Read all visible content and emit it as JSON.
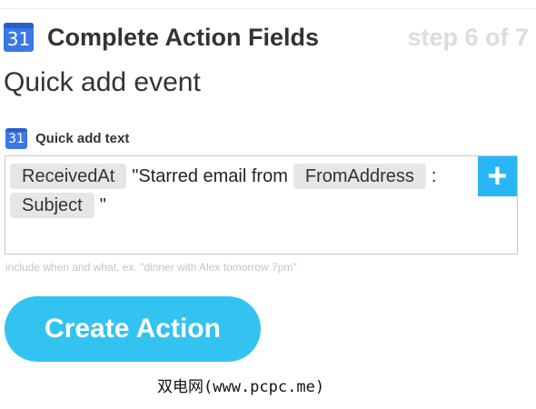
{
  "header": {
    "icon_number": "31",
    "title": "Complete Action Fields",
    "step": "step 6 of 7"
  },
  "action": {
    "name": "Quick add event"
  },
  "field": {
    "icon_number": "31",
    "label": "Quick add text",
    "line1": {
      "token1": "ReceivedAt",
      "text1": "\"Starred email from",
      "token2": "FromAddress",
      "text2": ":"
    },
    "line2": {
      "token1": "Subject",
      "text1": "\""
    },
    "add_button": "+",
    "help": "include when and what, ex. \"dinner with Alex tomorrow 7pm\""
  },
  "create_button": {
    "label": "Create Action"
  },
  "watermark": {
    "text": "双电网(www.pcpc.me)"
  },
  "colors": {
    "accent": "#29b6f6",
    "button": "#33c3f0",
    "calendar_icon": "#3b78e7"
  },
  "icons": {
    "header_icon": "google-calendar-icon",
    "field_icon": "google-calendar-icon",
    "add_icon": "plus-icon"
  }
}
